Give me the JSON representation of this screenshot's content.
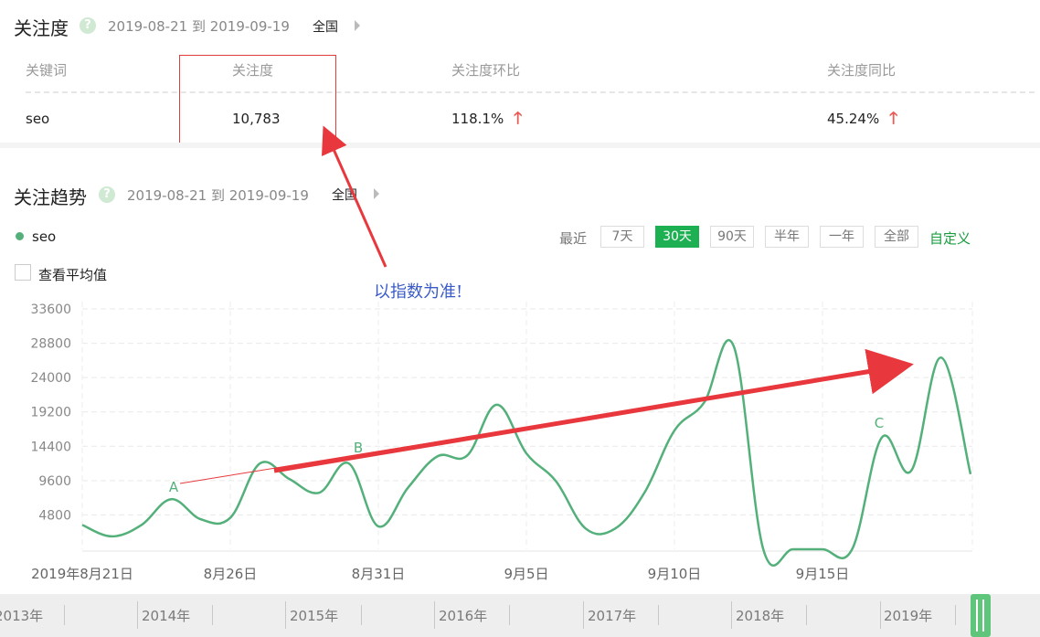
{
  "summary": {
    "title": "关注度",
    "help": "?",
    "date_range": "2019-08-21 到 2019-09-19",
    "region": "全国",
    "columns": [
      "关键词",
      "关注度",
      "关注度环比",
      "关注度同比"
    ],
    "row": {
      "keyword": "seo",
      "value": "10,783",
      "mom": "118.1%",
      "yoy": "45.24%"
    }
  },
  "trend": {
    "title": "关注趋势",
    "help": "?",
    "date_range": "2019-08-21 到 2019-09-19",
    "region": "全国",
    "legend": "seo",
    "range_label": "最近",
    "range_buttons": [
      "7天",
      "30天",
      "90天",
      "半年",
      "一年",
      "全部"
    ],
    "active_range": "30天",
    "custom_label": "自定义",
    "average_label": "查看平均值"
  },
  "annotation": {
    "note": "以指数为准!",
    "points": [
      "A",
      "B",
      "C"
    ]
  },
  "colors": {
    "line": "#54b07a",
    "accent_green": "#1db053",
    "annotation_red": "#e8383d",
    "note_blue": "#3a5bc7"
  },
  "chart_data": {
    "type": "line",
    "y_ticks": [
      "33600",
      "28800",
      "24000",
      "19200",
      "14400",
      "9600",
      "4800"
    ],
    "ylim": [
      0,
      33600
    ],
    "x_tick_labels": [
      "2019年8月21日",
      "8月26日",
      "8月31日",
      "9月5日",
      "9月10日",
      "9月15日"
    ],
    "grid": true,
    "series": [
      {
        "name": "seo",
        "values": [
          3400,
          1800,
          3400,
          7000,
          4200,
          4400,
          12000,
          9800,
          7900,
          12000,
          3200,
          8600,
          13000,
          13100,
          20200,
          13400,
          9500,
          2900,
          2900,
          8000,
          16600,
          20500,
          28400,
          0,
          0,
          0,
          0,
          15600,
          11000,
          26800,
          10500
        ]
      }
    ]
  },
  "timeline": {
    "years": [
      "2013年",
      "2014年",
      "2015年",
      "2016年",
      "2017年",
      "2018年",
      "2019年"
    ]
  }
}
